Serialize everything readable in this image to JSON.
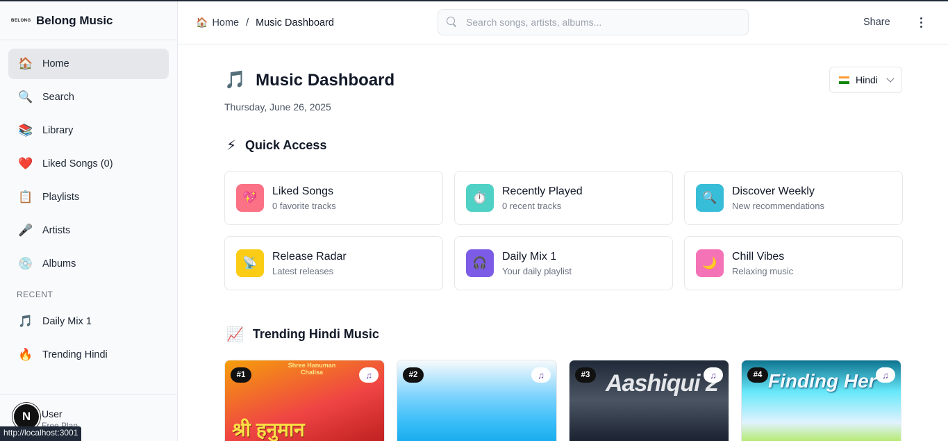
{
  "brand": {
    "logo_text": "BELONG",
    "name": "Belong Music"
  },
  "sidebar": {
    "items": [
      {
        "label": "Home",
        "icon": "🏠",
        "active": true
      },
      {
        "label": "Search",
        "icon": "🔍"
      },
      {
        "label": "Library",
        "icon": "📚"
      },
      {
        "label": "Liked Songs (0)",
        "icon": "❤️"
      },
      {
        "label": "Playlists",
        "icon": "📋"
      },
      {
        "label": "Artists",
        "icon": "🎤"
      },
      {
        "label": "Albums",
        "icon": "💿"
      }
    ],
    "recent_label": "RECENT",
    "recent": [
      {
        "label": "Daily Mix 1",
        "icon": "🎵"
      },
      {
        "label": "Trending Hindi",
        "icon": "🔥"
      }
    ],
    "user": {
      "initial": "N",
      "name": "User",
      "plan": "Free Plan"
    }
  },
  "status_url": "http://localhost:3001",
  "header": {
    "breadcrumb_home_icon": "🏠",
    "breadcrumb_home": "Home",
    "breadcrumb_sep": "/",
    "breadcrumb_current": "Music Dashboard",
    "search_placeholder": "Search songs, artists, albums...",
    "share_label": "Share"
  },
  "main": {
    "title_icon": "🎵",
    "title": "Music Dashboard",
    "date": "Thursday, June 26, 2025",
    "language": "Hindi",
    "quick_access": {
      "icon": "⚡",
      "title": "Quick Access",
      "cards": [
        {
          "title": "Liked Songs",
          "subtitle": "0 favorite tracks",
          "icon": "💖",
          "color": "#fb7185"
        },
        {
          "title": "Recently Played",
          "subtitle": "0 recent tracks",
          "icon": "⏱️",
          "color": "#4fd1c5"
        },
        {
          "title": "Discover Weekly",
          "subtitle": "New recommendations",
          "icon": "🔍",
          "color": "#38bdd8"
        },
        {
          "title": "Release Radar",
          "subtitle": "Latest releases",
          "icon": "📡",
          "color": "#facc15"
        },
        {
          "title": "Daily Mix 1",
          "subtitle": "Your daily playlist",
          "icon": "🎧",
          "color": "#7c5ce6"
        },
        {
          "title": "Chill Vibes",
          "subtitle": "Relaxing music",
          "icon": "🌙",
          "color": "#f472b6"
        }
      ]
    },
    "trending": {
      "icon": "📈",
      "title": "Trending Hindi Music",
      "cards": [
        {
          "rank": "#1",
          "art_text": "श्री हनुमान",
          "art_top": "Shree Hanuman Chalisa"
        },
        {
          "rank": "#2",
          "art_text": ""
        },
        {
          "rank": "#3",
          "art_text": "Aashiqui 2"
        },
        {
          "rank": "#4",
          "art_text": "Finding Her"
        }
      ]
    }
  }
}
